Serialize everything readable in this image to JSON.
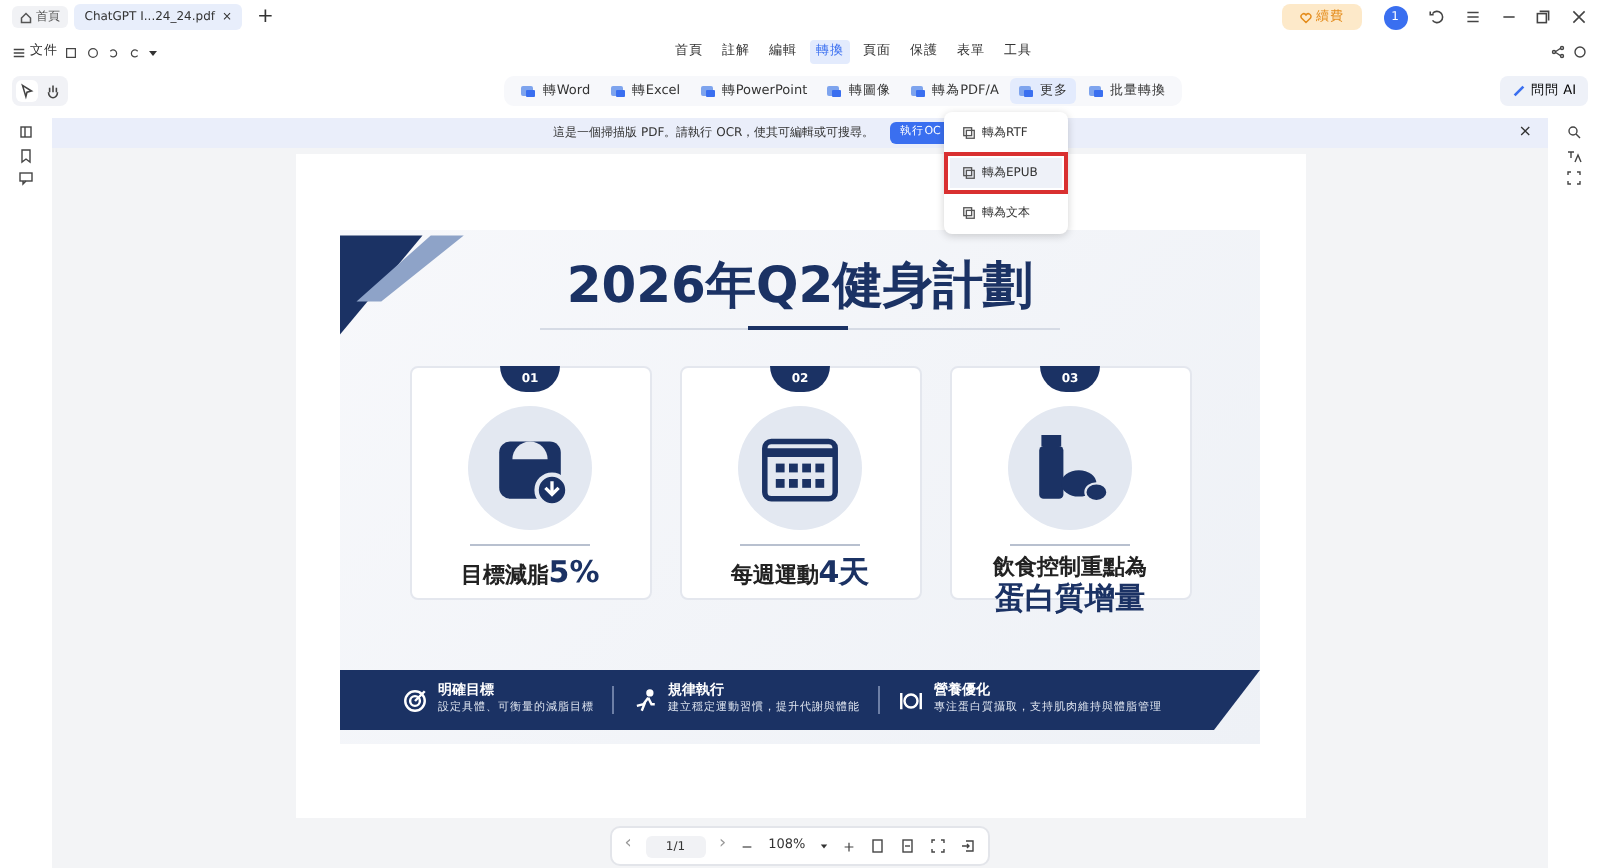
{
  "tabs": {
    "home": "首頁",
    "document_tab": {
      "title": "ChatGPT I...24_24.pdf",
      "close": "×"
    },
    "new_tab": "+"
  },
  "renew_button": "續費",
  "banner_close": "×",
  "prev_page": "‹",
  "next_page": "›",
  "avatar": "1",
  "file_menu": "文件",
  "menu": [
    {
      "label": "首頁",
      "selected": false
    },
    {
      "label": "註解",
      "selected": false
    },
    {
      "label": "編輯",
      "selected": false
    },
    {
      "label": "轉換",
      "selected": true
    },
    {
      "label": "頁面",
      "selected": false
    },
    {
      "label": "保護",
      "selected": false
    },
    {
      "label": "表單",
      "selected": false
    },
    {
      "label": "工具",
      "selected": false
    }
  ],
  "convert_toolbar": [
    {
      "label": "轉Word",
      "selected": false
    },
    {
      "label": "轉Excel",
      "selected": false
    },
    {
      "label": "轉PowerPoint",
      "selected": false
    },
    {
      "label": "轉圖像",
      "selected": false
    },
    {
      "label": "轉為PDF/A",
      "selected": false
    },
    {
      "label": "更多",
      "selected": true
    },
    {
      "label": "批量轉換",
      "selected": false
    }
  ],
  "ask_ai": "問問 AI",
  "ocr_banner": {
    "message": "這是一個掃描版 PDF。請執行 OCR，使其可編輯或可搜尋。",
    "button": "執行OC"
  },
  "dropdown": [
    {
      "label": "轉為RTF",
      "highlighted": false
    },
    {
      "label": "轉為EPUB",
      "highlighted": true
    },
    {
      "label": "轉為文本",
      "highlighted": false
    }
  ],
  "document": {
    "title": "2026年Q2健身計劃",
    "cards": [
      {
        "number": "01",
        "kind": "scale",
        "lines": [
          {
            "text": "目標減脂**5%**",
            "large": false
          }
        ]
      },
      {
        "number": "02",
        "kind": "calendar",
        "lines": [
          {
            "text": "每週運動**4天**",
            "large": false
          }
        ]
      },
      {
        "number": "03",
        "kind": "food",
        "lines": [
          {
            "text": "飲食控制重點為",
            "large": false
          },
          {
            "text": "蛋白質增量",
            "large": true
          }
        ]
      }
    ],
    "footer": [
      {
        "kind": "target",
        "title": "明確目標",
        "subtitle": "設定具體、可衡量的減脂目標"
      },
      {
        "kind": "runner",
        "title": "規律執行",
        "subtitle": "建立穩定運動習慣，提升代謝與體能"
      },
      {
        "kind": "plate",
        "title": "營養優化",
        "subtitle": "專注蛋白質攝取，支持肌肉維持與體脂管理"
      }
    ]
  },
  "page_nav": {
    "page": "1/1",
    "zoom": "108%"
  }
}
